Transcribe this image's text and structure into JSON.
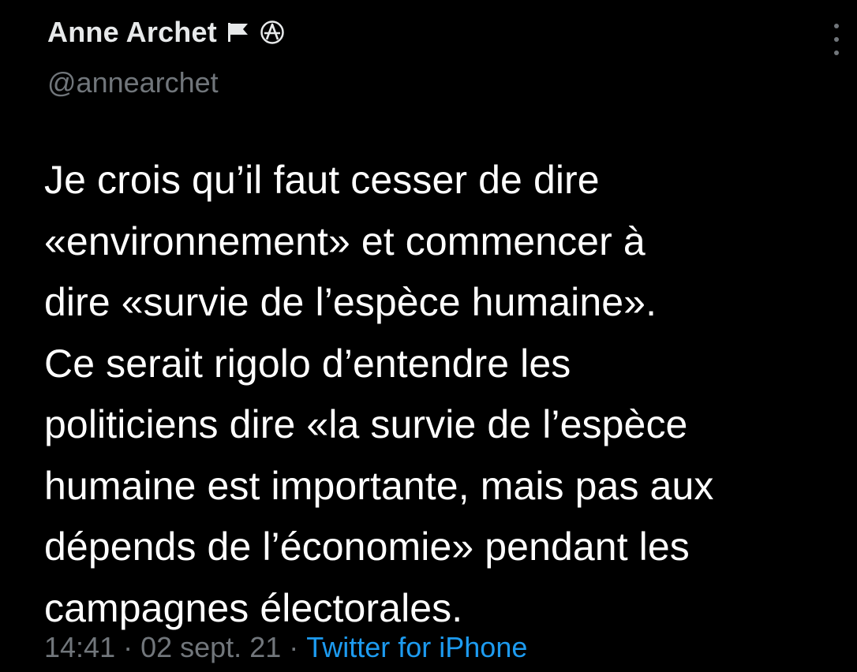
{
  "tweet": {
    "author": {
      "display_name": "Anne Archet",
      "handle": "@annearchet",
      "badges": [
        "flag-icon",
        "circle-a-icon"
      ]
    },
    "text": "Je crois qu’il faut cesser de dire\n«environnement» et commencer à\ndire «survie de l’espèce humaine».\nCe serait rigolo d’entendre les\npoliticiens dire «la survie de l’espèce\nhumaine est importante, mais pas aux\ndépends de l’économie» pendant les\ncampagnes électorales.",
    "meta": {
      "time": "14:41",
      "separator": "·",
      "date": "02 sept. 21",
      "source": "Twitter for iPhone"
    }
  },
  "colors": {
    "background": "#000000",
    "primary_text": "#ffffff",
    "secondary_text": "#71767b",
    "link": "#1d9bf0"
  }
}
